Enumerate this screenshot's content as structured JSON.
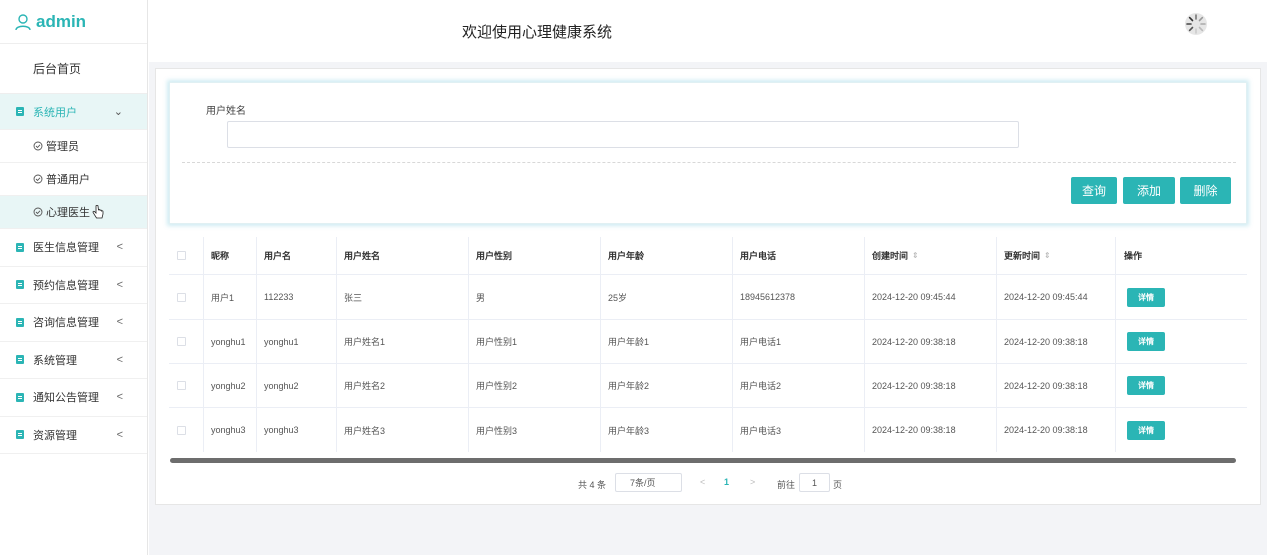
{
  "brand": {
    "name": "admin"
  },
  "sidebar": {
    "home": "后台首页",
    "items": [
      {
        "label": "系统用户",
        "arrow": "v"
      },
      {
        "label": "医生信息管理",
        "arrow": "<"
      },
      {
        "label": "预约信息管理",
        "arrow": "<"
      },
      {
        "label": "咨询信息管理",
        "arrow": "<"
      },
      {
        "label": "系统管理",
        "arrow": "<"
      },
      {
        "label": "通知公告管理",
        "arrow": "<"
      },
      {
        "label": "资源管理",
        "arrow": "<"
      }
    ],
    "subitems": [
      "管理员",
      "普通用户",
      "心理医生"
    ]
  },
  "header": {
    "title": "欢迎使用心理健康系统"
  },
  "search": {
    "label": "用户姓名",
    "value": "",
    "buttons": {
      "query": "查询",
      "add": "添加",
      "delete": "删除"
    }
  },
  "table": {
    "columns": [
      "昵称",
      "用户名",
      "用户姓名",
      "用户性别",
      "用户年龄",
      "用户电话",
      "创建时间",
      "更新时间",
      "操作"
    ],
    "rows": [
      [
        "用户1",
        "112233",
        "张三",
        "男",
        "25岁",
        "18945612378",
        "2024-12-20 09:45:44",
        "2024-12-20 09:45:44",
        "详情"
      ],
      [
        "yonghu1",
        "yonghu1",
        "用户姓名1",
        "用户性别1",
        "用户年龄1",
        "用户电话1",
        "2024-12-20 09:38:18",
        "2024-12-20 09:38:18",
        "详情"
      ],
      [
        "yonghu2",
        "yonghu2",
        "用户姓名2",
        "用户性别2",
        "用户年龄2",
        "用户电话2",
        "2024-12-20 09:38:18",
        "2024-12-20 09:38:18",
        "详情"
      ],
      [
        "yonghu3",
        "yonghu3",
        "用户姓名3",
        "用户性别3",
        "用户年龄3",
        "用户电话3",
        "2024-12-20 09:38:18",
        "2024-12-20 09:38:18",
        "详情"
      ]
    ]
  },
  "pagination": {
    "total": "共 4 条",
    "page_size": "7条/页",
    "prev": "<",
    "current": "1",
    "next": ">",
    "goto_label": "前往",
    "goto_value": "1",
    "page_suffix": "页"
  },
  "colors": {
    "accent": "#2bb5b5",
    "background": "#f3f4f7"
  }
}
